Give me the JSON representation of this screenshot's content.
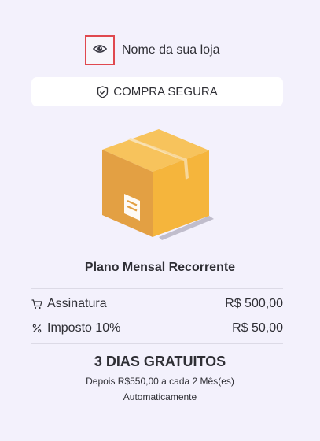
{
  "store": {
    "name": "Nome da sua loja",
    "logo_icon": "eye-logo-icon"
  },
  "secure": {
    "label": "COMPRA SEGURA",
    "icon": "shield-check-icon"
  },
  "product": {
    "image_icon": "cardboard-box-icon",
    "plan_name": "Plano Mensal Recorrente"
  },
  "summary": {
    "rows": [
      {
        "icon": "cart-icon",
        "label": "Assinatura",
        "value": "R$ 500,00"
      },
      {
        "icon": "percent-icon",
        "label": "Imposto 10%",
        "value": "R$ 50,00"
      }
    ]
  },
  "trial": {
    "title": "3 DIAS GRATUITOS",
    "line1": "Depois R$550,00 a cada 2 Mês(es)",
    "line2": "Automaticamente"
  },
  "colors": {
    "background": "#f3f1fc",
    "box_main": "#f5b53c",
    "box_dark": "#e3a043",
    "highlight_border": "#e0494f"
  }
}
